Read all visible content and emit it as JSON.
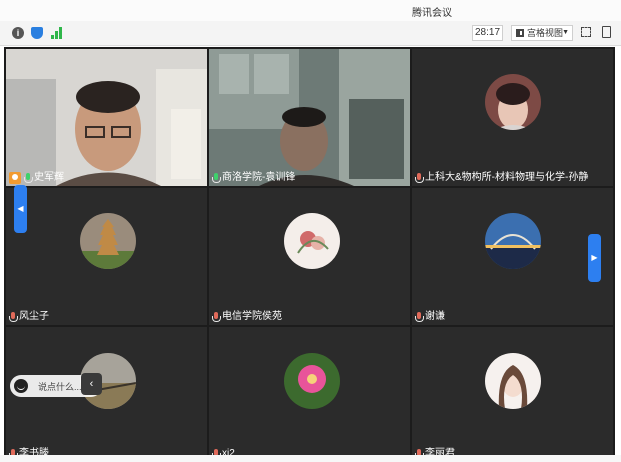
{
  "window": {
    "title": "腾讯会议"
  },
  "toolbar": {
    "info_icon": "info-icon",
    "timer": "28:17",
    "view_mode": "宫格视图",
    "fullscreen_icon": "fullscreen-icon",
    "popout_icon": "popout-icon"
  },
  "participants": [
    {
      "name": "史军辉",
      "mic": "active"
    },
    {
      "name": "商洛学院-袁训锋",
      "mic": "active"
    },
    {
      "name": "上科大&物构所-材料物理与化学-孙静",
      "mic": "muted"
    },
    {
      "name": "风尘子",
      "mic": "muted"
    },
    {
      "name": "电信学院侯苑",
      "mic": "muted"
    },
    {
      "name": "谢谦",
      "mic": "muted"
    },
    {
      "name": "李书滕",
      "mic": "muted"
    },
    {
      "name": "xi2",
      "mic": "muted"
    },
    {
      "name": "李丽君",
      "mic": "muted"
    }
  ],
  "chat": {
    "placeholder": "说点什么..."
  },
  "colors": {
    "accent": "#2d7ff0",
    "tile_bg": "#2b2b2b",
    "grid_bg": "#1c1c1c"
  }
}
